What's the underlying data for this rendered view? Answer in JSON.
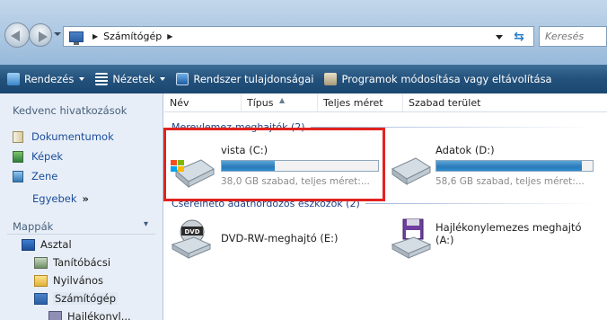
{
  "address": {
    "path": [
      "Számítógép"
    ],
    "search_placeholder": "Keresés"
  },
  "toolbar": {
    "items": [
      {
        "label": "Rendezés",
        "dropdown": true
      },
      {
        "label": "Nézetek",
        "dropdown": true
      },
      {
        "label": "Rendszer tulajdonságai",
        "dropdown": false
      },
      {
        "label": "Programok módosítása vagy eltávolítása",
        "dropdown": false
      }
    ]
  },
  "sidebar": {
    "favorites_header": "Kedvenc hivatkozások",
    "favorites": [
      "Dokumentumok",
      "Képek",
      "Zene"
    ],
    "more_label": "Egyebek",
    "more_glyph": "»",
    "folders_header": "Mappák",
    "tree": [
      "Asztal",
      "Tanítóbácsi",
      "Nyilvános",
      "Számítógép",
      "Hajlékonyl..."
    ]
  },
  "columns": [
    "Név",
    "Típus",
    "Teljes méret",
    "Szabad terület"
  ],
  "groups": {
    "hard_disks": "Merevlemez-meghajtók (2)",
    "removable": "Cserélhető adathordozós eszközök (2)"
  },
  "drives": [
    {
      "name": "vista (C:)",
      "detail": "38,0 GB szabad, teljes méret:...",
      "used_fraction": 0.34
    },
    {
      "name": "Adatok (D:)",
      "detail": "58,6 GB szabad, teljes méret:...",
      "used_fraction": 0.93
    }
  ],
  "removable": [
    {
      "name": "DVD-RW-meghajtó (E:)",
      "icon_label": "DVD"
    },
    {
      "name": "Hajlékonylemezes meghajtó (A:)"
    }
  ],
  "colors": {
    "highlight": "#e1231f",
    "accent": "#1e3f80"
  }
}
